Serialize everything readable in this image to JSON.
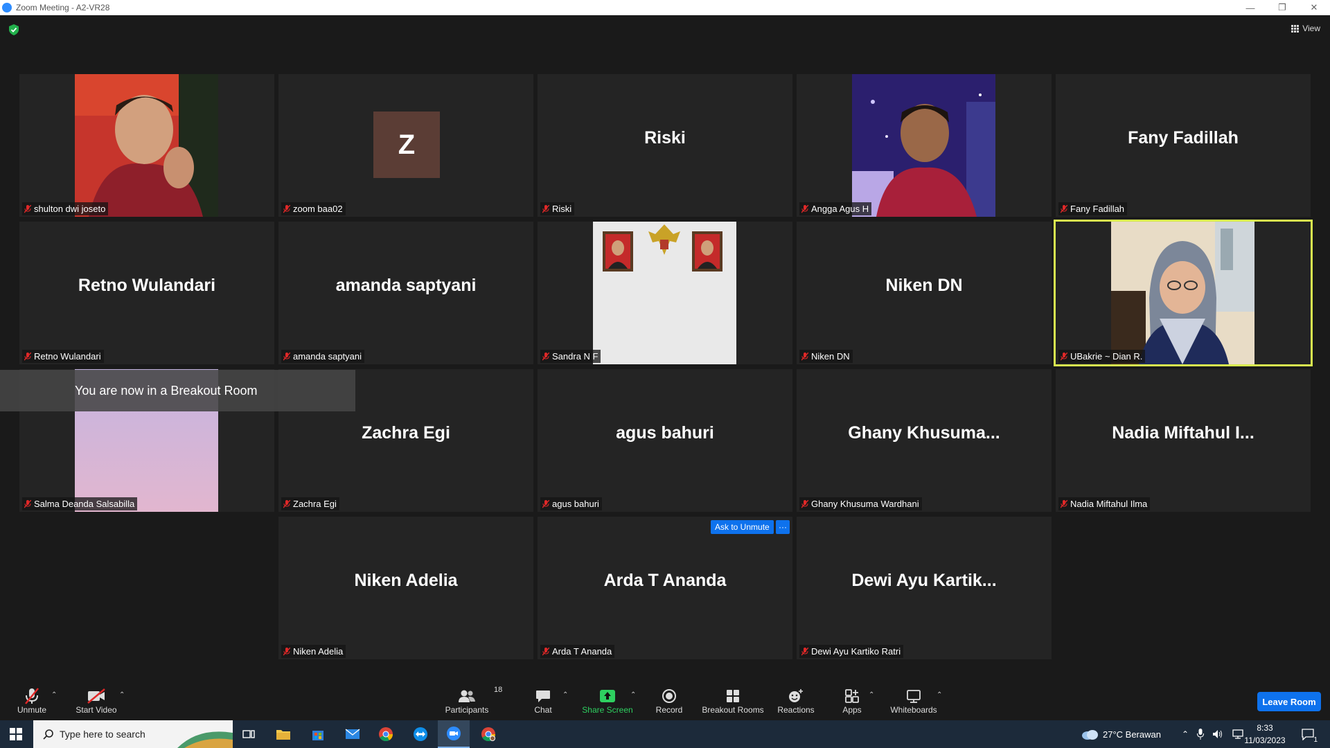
{
  "window": {
    "title": "Zoom Meeting - A2-VR28",
    "min": "—",
    "restore": "❐",
    "close": "✕"
  },
  "view_label": "View",
  "tiles": [
    {
      "big": "",
      "label": "shulton dwi joseto"
    },
    {
      "big": "Z",
      "label": "zoom baa02"
    },
    {
      "big": "Riski",
      "label": "Riski"
    },
    {
      "big": "",
      "label": "Angga Agus H"
    },
    {
      "big": "Fany Fadillah",
      "label": "Fany Fadillah"
    },
    {
      "big": "Retno Wulandari",
      "label": "Retno Wulandari"
    },
    {
      "big": "amanda saptyani",
      "label": "amanda saptyani"
    },
    {
      "big": "",
      "label": "Sandra N F"
    },
    {
      "big": "Niken DN",
      "label": "Niken DN"
    },
    {
      "big": "",
      "label": "UBakrie ~ Dian R."
    },
    {
      "big": "",
      "label": "Salma Deanda Salsabilla"
    },
    {
      "big": "Zachra Egi",
      "label": "Zachra Egi"
    },
    {
      "big": "agus bahuri",
      "label": "agus bahuri"
    },
    {
      "big": "Ghany  Khusuma...",
      "label": "Ghany Khusuma Wardhani"
    },
    {
      "big": "Nadia Miftahul I...",
      "label": "Nadia Miftahul Ilma"
    },
    {
      "big": "Niken Adelia",
      "label": "Niken Adelia"
    },
    {
      "big": "Arda T Ananda",
      "label": "Arda T Ananda"
    },
    {
      "big": "Dewi  Ayu  Kartik...",
      "label": "Dewi Ayu Kartiko Ratri"
    }
  ],
  "banner": "You are now in a Breakout Room",
  "ask_to_unmute": "Ask to Unmute",
  "more": "···",
  "toolbar": {
    "unmute": "Unmute",
    "start_video": "Start Video",
    "participants": "Participants",
    "participants_count": "18",
    "chat": "Chat",
    "share_screen": "Share Screen",
    "record": "Record",
    "breakout_rooms": "Breakout Rooms",
    "reactions": "Reactions",
    "apps": "Apps",
    "whiteboards": "Whiteboards",
    "leave": "Leave Room"
  },
  "taskbar": {
    "search_placeholder": "Type here to search",
    "weather": "27°C  Berawan",
    "time": "8:33",
    "date": "11/03/2023",
    "notif_count": "1"
  },
  "colors": {
    "accent": "#0e72ed",
    "active_speaker": "#d8ea4f",
    "green": "#2ed060"
  }
}
